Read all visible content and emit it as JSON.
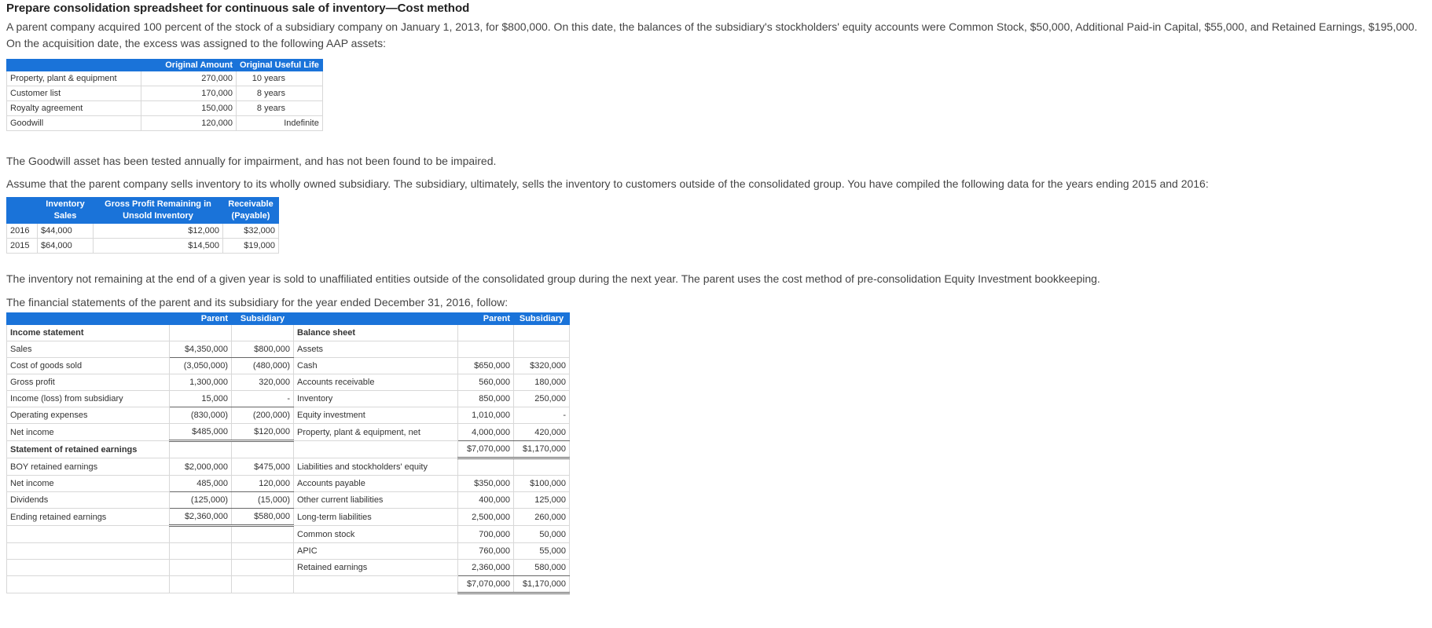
{
  "title": "Prepare consolidation spreadsheet for continuous sale of inventory—Cost method",
  "intro": "A parent company acquired 100 percent of the stock of a subsidiary company on January 1, 2013, for $800,000. On this date, the balances of the subsidiary's stockholders' equity accounts were Common Stock, $50,000, Additional Paid-in Capital, $55,000, and Retained Earnings, $195,000. On the acquisition date, the excess was assigned to the following AAP assets:",
  "aap_table": {
    "headers": [
      "",
      "Original Amount",
      "Original Useful Life"
    ],
    "rows": [
      {
        "asset": "Property, plant & equipment",
        "amount": "270,000",
        "life_num": "10",
        "life_unit": "years"
      },
      {
        "asset": "Customer list",
        "amount": "170,000",
        "life_num": "8",
        "life_unit": "years"
      },
      {
        "asset": "Royalty agreement",
        "amount": "150,000",
        "life_num": "8",
        "life_unit": "years"
      },
      {
        "asset": "Goodwill",
        "amount": "120,000",
        "life_num": "",
        "life_unit": "Indefinite"
      }
    ]
  },
  "goodwill_note": "The Goodwill asset has been tested annually for impairment, and has not been found to be impaired.",
  "assume_text": "Assume that the parent company sells inventory to its wholly owned subsidiary. The subsidiary, ultimately, sells the inventory to customers outside of the consolidated group. You have compiled the following data for the years ending 2015 and 2016:",
  "inventory_table": {
    "headers": [
      "",
      "Inventory Sales",
      "Gross Profit Remaining in Unsold Inventory",
      "Receivable (Payable)"
    ],
    "header_lines": [
      [
        "Inventory",
        "Sales"
      ],
      [
        "Gross Profit Remaining in",
        "Unsold Inventory"
      ],
      [
        "Receivable",
        "(Payable)"
      ]
    ],
    "rows": [
      {
        "year": "2016",
        "sales": "$44,000",
        "gp": "$12,000",
        "recv": "$32,000"
      },
      {
        "year": "2015",
        "sales": "$64,000",
        "gp": "$14,500",
        "recv": "$19,000"
      }
    ]
  },
  "inventory_note": "The inventory not remaining at the end of a given year is sold to unaffiliated entities outside of the consolidated group during the next year. The parent uses the cost method of pre-consolidation Equity Investment bookkeeping.",
  "fs_intro": "The financial statements of the parent and its subsidiary for the year ended December 31, 2016, follow:",
  "fs_table": {
    "headers": {
      "parent": "Parent",
      "subsidiary": "Subsidiary"
    },
    "rows": [
      [
        "Income statement",
        "",
        "",
        "Balance sheet",
        "",
        ""
      ],
      [
        "Sales",
        "$4,350,000",
        "$800,000",
        "Assets",
        "",
        ""
      ],
      [
        "Cost of goods sold",
        "(3,050,000)",
        "(480,000)",
        "Cash",
        "$650,000",
        "$320,000"
      ],
      [
        "Gross profit",
        "1,300,000",
        "320,000",
        "Accounts receivable",
        "560,000",
        "180,000"
      ],
      [
        "Income (loss) from subsidiary",
        "15,000",
        "-",
        "Inventory",
        "850,000",
        "250,000"
      ],
      [
        "Operating expenses",
        "(830,000)",
        "(200,000)",
        "Equity investment",
        "1,010,000",
        "-"
      ],
      [
        "Net income",
        "$485,000",
        "$120,000",
        "Property, plant & equipment, net",
        "4,000,000",
        "420,000"
      ],
      [
        "Statement of retained earnings",
        "",
        "",
        "",
        "$7,070,000",
        "$1,170,000"
      ],
      [
        "BOY retained earnings",
        "$2,000,000",
        "$475,000",
        "Liabilities and stockholders' equity",
        "",
        ""
      ],
      [
        "Net income",
        "485,000",
        "120,000",
        "Accounts payable",
        "$350,000",
        "$100,000"
      ],
      [
        "Dividends",
        "(125,000)",
        "(15,000)",
        "Other current liabilities",
        "400,000",
        "125,000"
      ],
      [
        "Ending retained earnings",
        "$2,360,000",
        "$580,000",
        "Long-term liabilities",
        "2,500,000",
        "260,000"
      ],
      [
        "",
        "",
        "",
        "Common stock",
        "700,000",
        "50,000"
      ],
      [
        "",
        "",
        "",
        "APIC",
        "760,000",
        "55,000"
      ],
      [
        "",
        "",
        "",
        "Retained earnings",
        "2,360,000",
        "580,000"
      ],
      [
        "",
        "",
        "",
        "",
        "$7,070,000",
        "$1,170,000"
      ]
    ]
  }
}
